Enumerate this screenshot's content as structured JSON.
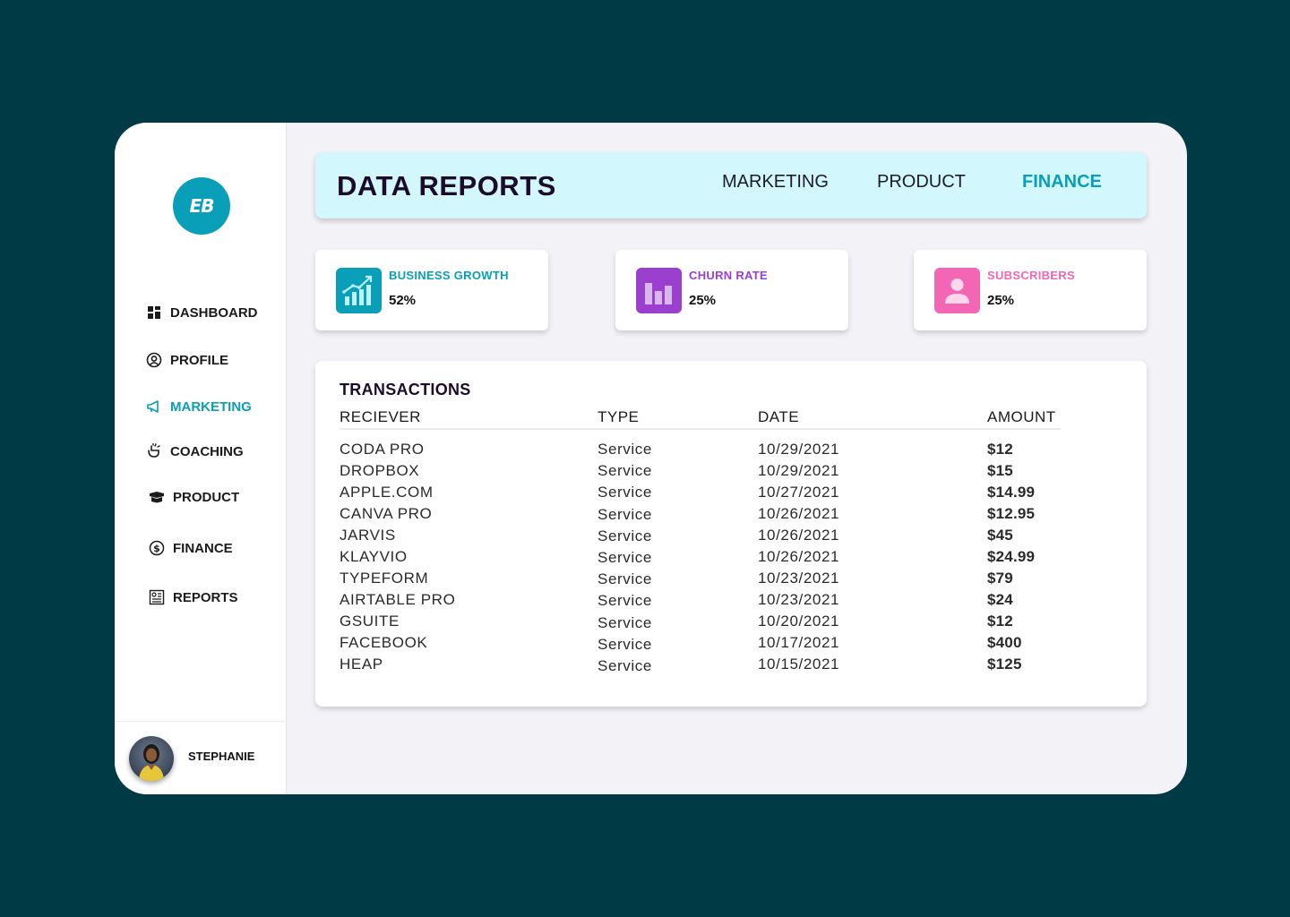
{
  "brand": {
    "logo_text": "EB",
    "accent": "#0a9fb8"
  },
  "sidebar": {
    "items": [
      {
        "label": "DASHBOARD",
        "icon": "grid-icon"
      },
      {
        "label": "PROFILE",
        "icon": "user-circle-icon"
      },
      {
        "label": "MARKETING",
        "icon": "megaphone-icon",
        "active": true
      },
      {
        "label": "COACHING",
        "icon": "hand-icon"
      },
      {
        "label": "PRODUCT",
        "icon": "box-icon"
      },
      {
        "label": "FINANCE",
        "icon": "dollar-circle-icon"
      },
      {
        "label": "REPORTS",
        "icon": "report-icon"
      }
    ],
    "user": {
      "name": "STEPHANIE"
    }
  },
  "header": {
    "title": "DATA REPORTS",
    "tabs": [
      {
        "label": "MARKETING",
        "active": false
      },
      {
        "label": "PRODUCT",
        "active": false
      },
      {
        "label": "FINANCE",
        "active": true
      }
    ]
  },
  "stats": [
    {
      "label": "BUSINESS GROWTH",
      "value": "52%",
      "color": "#0a9fb8",
      "icon": "growth-chart-icon"
    },
    {
      "label": "CHURN RATE",
      "value": "25%",
      "color": "#9b3fcf",
      "icon": "bar-chart-icon"
    },
    {
      "label": "SUBSCRIBERS",
      "value": "25%",
      "color": "#f266b3",
      "icon": "person-icon"
    }
  ],
  "transactions": {
    "title": "TRANSACTIONS",
    "columns": [
      "RECIEVER",
      "TYPE",
      "DATE",
      "AMOUNT"
    ],
    "rows": [
      {
        "receiver": "CODA PRO",
        "type": "Service",
        "date": "10/29/2021",
        "amount": "$12"
      },
      {
        "receiver": "DROPBOX",
        "type": "Service",
        "date": "10/29/2021",
        "amount": "$15"
      },
      {
        "receiver": "APPLE.COM",
        "type": "Service",
        "date": "10/27/2021",
        "amount": "$14.99"
      },
      {
        "receiver": "CANVA PRO",
        "type": "Service",
        "date": "10/26/2021",
        "amount": "$12.95"
      },
      {
        "receiver": "JARVIS",
        "type": "Service",
        "date": "10/26/2021",
        "amount": "$45"
      },
      {
        "receiver": "KLAYVIO",
        "type": "Service",
        "date": "10/26/2021",
        "amount": "$24.99"
      },
      {
        "receiver": "TYPEFORM",
        "type": "Service",
        "date": "10/23/2021",
        "amount": "$79"
      },
      {
        "receiver": "AIRTABLE PRO",
        "type": "Service",
        "date": "10/23/2021",
        "amount": "$24"
      },
      {
        "receiver": "GSUITE",
        "type": "Service",
        "date": "10/20/2021",
        "amount": "$12"
      },
      {
        "receiver": "FACEBOOK",
        "type": "Service",
        "date": "10/17/2021",
        "amount": "$400"
      },
      {
        "receiver": "HEAP",
        "type": "Service",
        "date": "10/15/2021",
        "amount": "$125"
      }
    ]
  }
}
